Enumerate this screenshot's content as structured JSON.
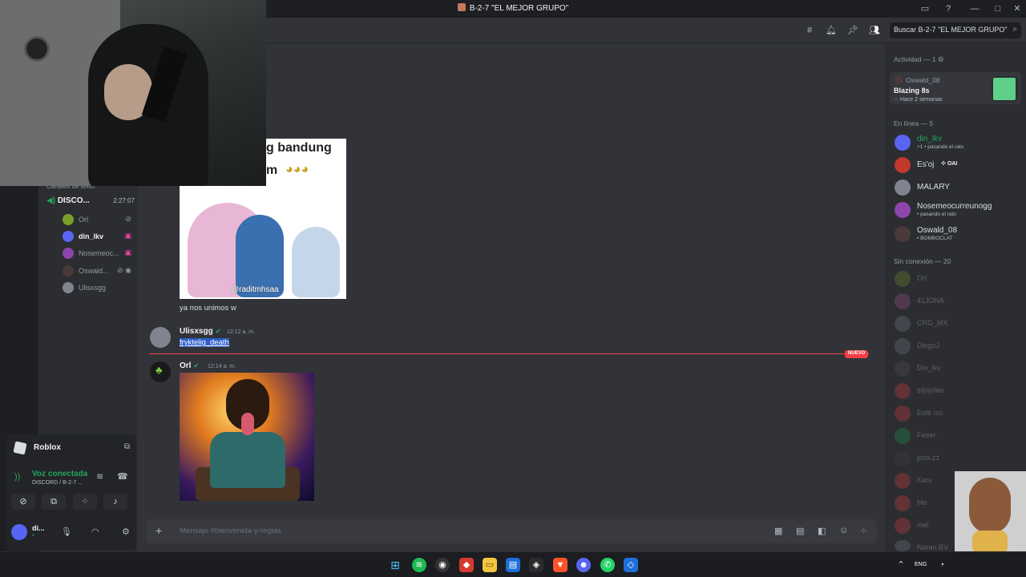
{
  "window": {
    "title": "B-2-7 \"EL MEJOR GRUPO\""
  },
  "sidebar": {
    "text_channels_header": "Canales de texto",
    "voice_channel": {
      "name": "DISCO...",
      "time": "2:27:07"
    },
    "voice_users": [
      {
        "name": "Orl",
        "color": "#7a9e2a"
      },
      {
        "name": "din_lkv",
        "color": "#5865f2",
        "active": true
      },
      {
        "name": "Nosemeoc...",
        "color": "#8e44ad"
      },
      {
        "name": "Oswald...",
        "color": "#4a3a3a"
      },
      {
        "name": "Ulisxsgg",
        "color": "#80848e"
      }
    ]
  },
  "user_panel": {
    "activity": "Roblox",
    "voice_status": "Voz conectada",
    "voice_location": "DISCORD / B-2-7 ...",
    "username": "di...",
    "user_status": "•"
  },
  "header": {
    "search_placeholder": "Buscar B-2-7 \"EL MEJOR GRUPO\""
  },
  "messages": {
    "meme1_caption": "g bandung",
    "meme1_caption2": "m",
    "meme1_watermark": "@raditmhsaa",
    "text1": "ya nos unimos w",
    "msg2": {
      "author": "Ulisxsgg",
      "time": "12:12 a. m.",
      "text": "fryktelig_death"
    },
    "new_label": "NUEVO",
    "msg3": {
      "author": "Orl",
      "time": "12:14 a. m."
    }
  },
  "composer": {
    "placeholder": "Mensaje #bienvenida-y-reglas"
  },
  "members": {
    "activity_title": "Actividad — 1",
    "activity": {
      "user": "Oswald_08",
      "game": "Blazing 8s",
      "time": "Hace 2 semanas"
    },
    "online_title": "En línea — 5",
    "online": [
      {
        "name": "din_lkv",
        "sub": "+1 • pasando el rato",
        "color": "#5865f2",
        "name_color": "#23a55a"
      },
      {
        "name": "Es'oj",
        "sub": "",
        "tag": "OAI",
        "color": "#c0392b",
        "name_color": "#dbdee1"
      },
      {
        "name": "MALARY",
        "sub": "",
        "color": "#80848e",
        "name_color": "#dbdee1"
      },
      {
        "name": "Nosemeocurreunogg",
        "sub": "• pasando el rato",
        "color": "#8e44ad",
        "name_color": "#dbdee1"
      },
      {
        "name": "Oswald_08",
        "sub": "• BOMBOCLAT",
        "color": "#4a3a3a",
        "name_color": "#dbdee1"
      }
    ],
    "offline_title": "Sin conexión — 20",
    "offline": [
      {
        "name": "Orl",
        "color": "#7a9e2a"
      },
      {
        "name": "41JONA",
        "color": "#b05aa0"
      },
      {
        "name": "CRG_MX",
        "color": "#80848e"
      },
      {
        "name": "DiegoJ",
        "color": "#80848e"
      },
      {
        "name": "Din_lkv",
        "color": "#555"
      },
      {
        "name": "eljojofan",
        "color": "#f23f43"
      },
      {
        "name": "Este",
        "color": "#f23f43",
        "tag": "ISO"
      },
      {
        "name": "Feeer",
        "color": "#23a55a"
      },
      {
        "name": "jonx.zz",
        "color": "#444"
      },
      {
        "name": "Karu",
        "color": "#f23f43"
      },
      {
        "name": "Me",
        "color": "#f23f43"
      },
      {
        "name": "mel",
        "color": "#f23f43"
      },
      {
        "name": "Naran BV",
        "color": "#80848e"
      }
    ]
  },
  "taskbar": {
    "lang": "ENG"
  }
}
